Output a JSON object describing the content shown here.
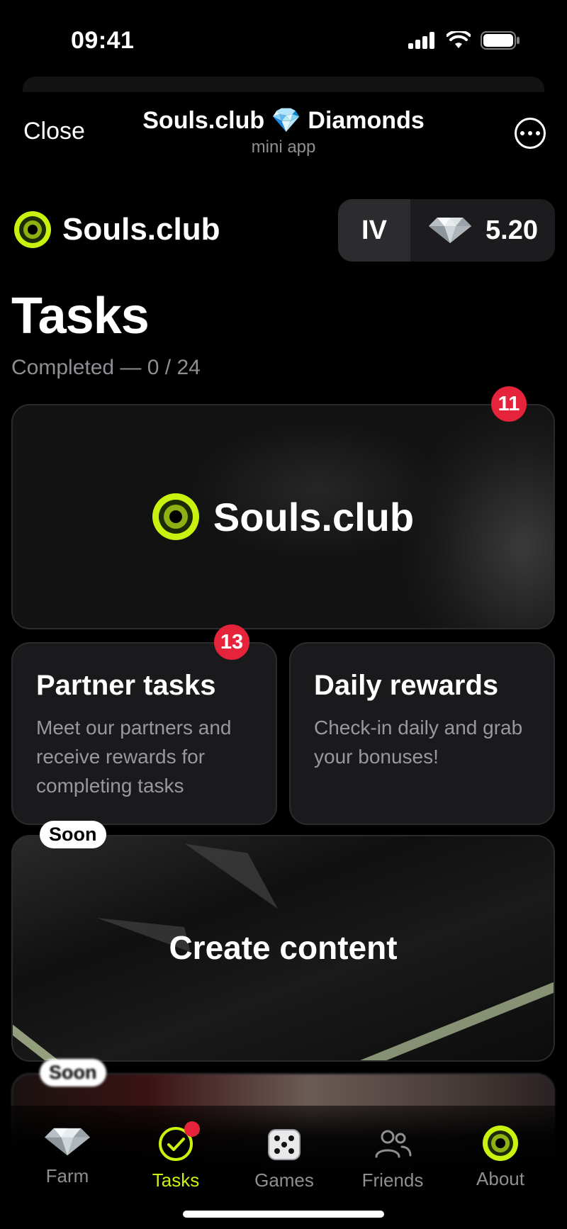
{
  "status_bar": {
    "time": "09:41"
  },
  "header": {
    "close_label": "Close",
    "title": "Souls.club 💎 Diamonds",
    "subtitle": "mini app"
  },
  "brand": {
    "name": "Souls.club"
  },
  "balance": {
    "level": "IV",
    "amount": "5.20"
  },
  "page": {
    "title": "Tasks",
    "subtitle": "Completed — 0 / 24"
  },
  "cards": {
    "souls": {
      "name": "Souls.club",
      "badge": "11"
    },
    "partner": {
      "title": "Partner tasks",
      "description": "Meet our partners and receive rewards for completing tasks",
      "badge": "13"
    },
    "daily": {
      "title": "Daily rewards",
      "description": "Check-in daily and grab your bonuses!"
    },
    "create": {
      "title": "Create content",
      "tag": "Soon"
    },
    "next": {
      "tag": "Soon"
    }
  },
  "tabs": [
    {
      "label": "Farm",
      "icon": "diamond-icon"
    },
    {
      "label": "Tasks",
      "icon": "check-circle-icon",
      "active": true
    },
    {
      "label": "Games",
      "icon": "dice-icon"
    },
    {
      "label": "Friends",
      "icon": "friends-icon"
    },
    {
      "label": "About",
      "icon": "souls-logo-icon"
    }
  ],
  "colors": {
    "accent": "#c9f20f",
    "badge": "#e5233a",
    "background": "#000000",
    "card": "#1a1a1c"
  }
}
